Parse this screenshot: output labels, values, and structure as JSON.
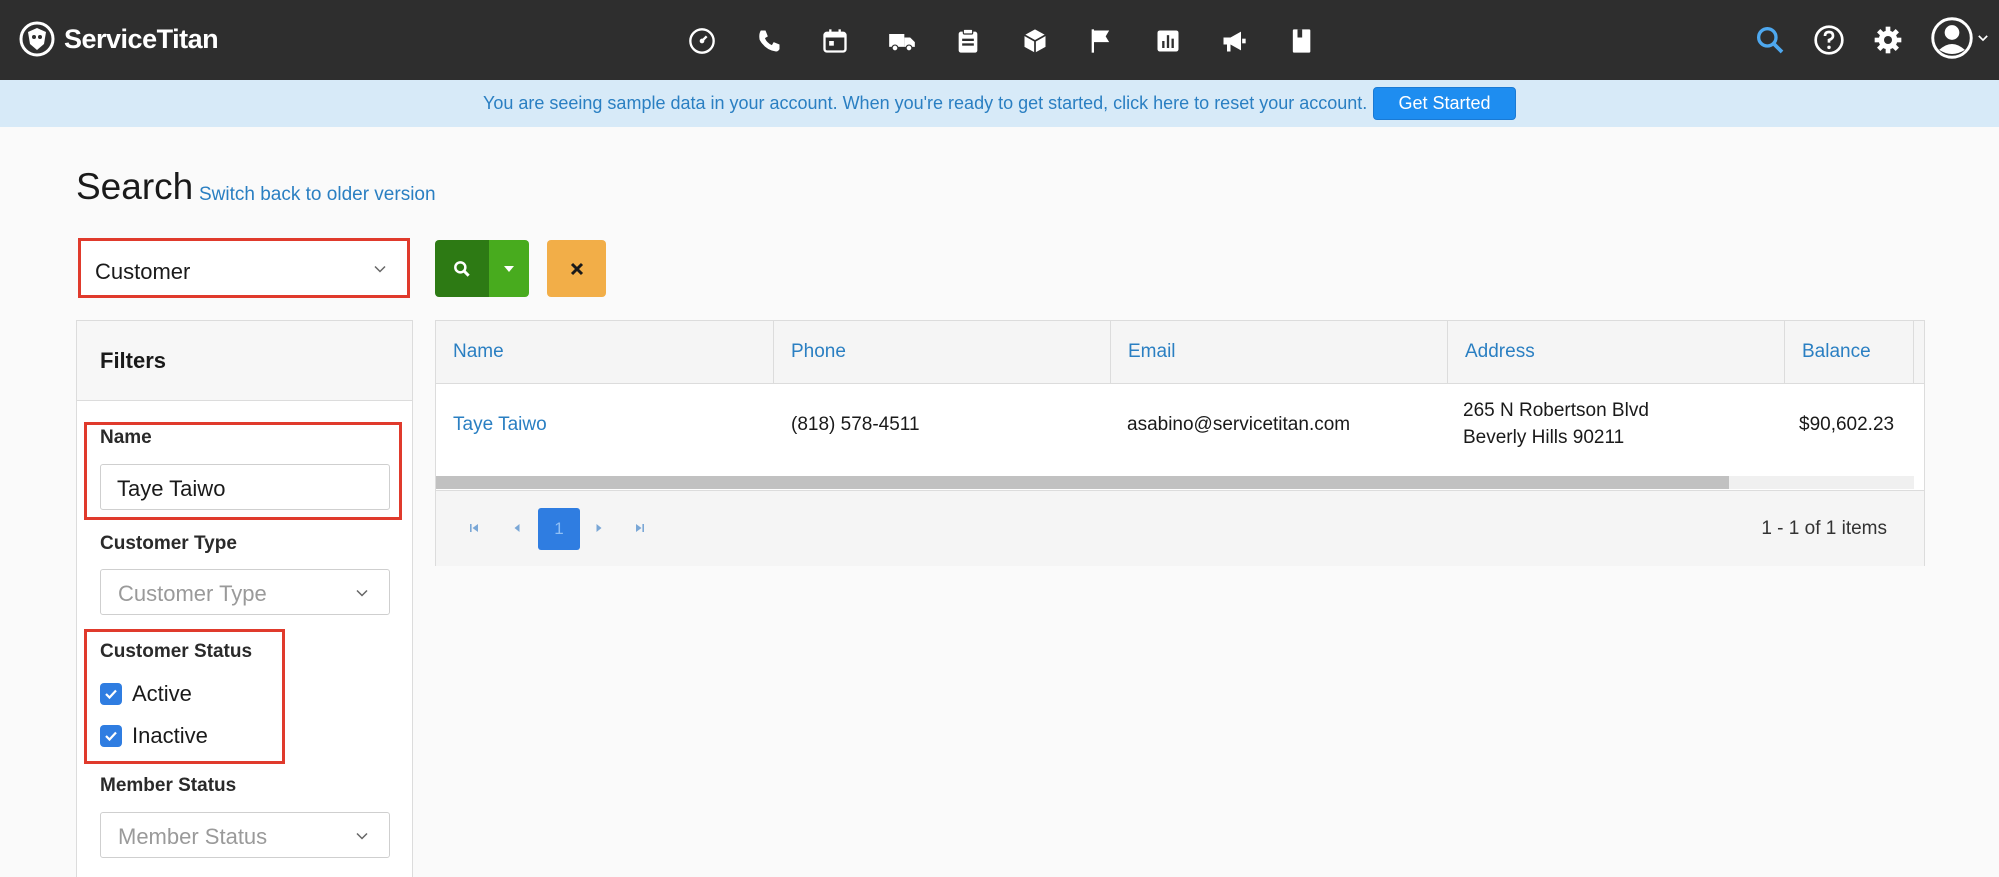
{
  "app": {
    "brand": "ServiceTitan",
    "accent_color": "#2a7fc2",
    "nav_icons": [
      "dashboard-icon",
      "phone-icon",
      "calendar-icon",
      "truck-icon",
      "clipboard-icon",
      "box-icon",
      "flag-icon",
      "reports-icon",
      "megaphone-icon",
      "book-icon"
    ],
    "right_icons": [
      "search-icon",
      "help-icon",
      "settings-icon",
      "user-avatar-icon"
    ]
  },
  "banner": {
    "text": "You are seeing sample data in your account. When you're ready to get started, click here to reset your account.",
    "button_label": "Get Started"
  },
  "page": {
    "title": "Search",
    "switch_link": "Switch back to older version"
  },
  "search": {
    "type_selected": "Customer"
  },
  "filters": {
    "title": "Filters",
    "name_label": "Name",
    "name_value": "Taye Taiwo",
    "customer_type_label": "Customer Type",
    "customer_type_placeholder": "Customer Type",
    "customer_status_label": "Customer Status",
    "status_options": [
      {
        "label": "Active",
        "checked": true
      },
      {
        "label": "Inactive",
        "checked": true
      }
    ],
    "member_status_label": "Member Status",
    "member_status_placeholder": "Member Status"
  },
  "grid": {
    "columns": [
      "Name",
      "Phone",
      "Email",
      "Address",
      "Balance"
    ],
    "rows": [
      {
        "name": "Taye Taiwo",
        "phone": "(818) 578-4511",
        "email": "asabino@servicetitan.com",
        "address_line1": "265 N Robertson Blvd",
        "address_line2": "Beverly Hills 90211",
        "balance": "$90,602.23"
      }
    ],
    "current_page": "1",
    "page_info": "1 - 1 of 1 items"
  }
}
